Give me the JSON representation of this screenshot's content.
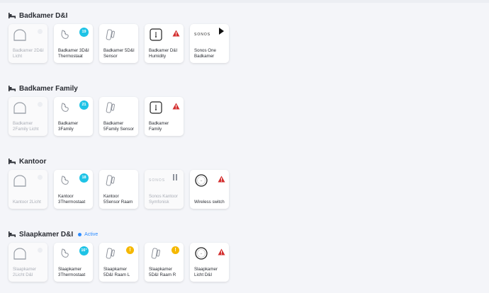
{
  "sections": [
    {
      "title": "Badkamer D&I",
      "tiles": [
        {
          "label": "Badkamer 2D&I Licht",
          "icon": "light-icon",
          "badge": "dot",
          "off": true
        },
        {
          "label": "Badkamer 3D&I Thermostaat",
          "icon": "thermostat-icon",
          "badge": "number",
          "badge_value": "19"
        },
        {
          "label": "Badkamer 5D&I Sensor",
          "icon": "door-sensor-icon",
          "badge": "none"
        },
        {
          "label": "Badkamer D&I Humidity",
          "icon": "humidity-icon",
          "badge": "alert"
        },
        {
          "label": "Sonos One Badkamer",
          "icon": "sonos-icon",
          "brand": "SONOS",
          "badge": "play"
        }
      ]
    },
    {
      "title": "Badkamer Family",
      "tiles": [
        {
          "label": "Badkamer 2Family Licht",
          "icon": "light-icon",
          "badge": "dot",
          "off": true
        },
        {
          "label": "Badkamer 3Family",
          "icon": "thermostat-icon",
          "badge": "number",
          "badge_value": "21"
        },
        {
          "label": "Badkamer 5Family Sensor",
          "icon": "door-sensor-icon",
          "badge": "none"
        },
        {
          "label": "Badkamer Family",
          "icon": "humidity-icon",
          "badge": "alert"
        }
      ]
    },
    {
      "title": "Kantoor",
      "tiles": [
        {
          "label": "Kantoor 2Licht",
          "icon": "light-icon",
          "badge": "dot",
          "off": true
        },
        {
          "label": "Kantoor 3Thermostaat",
          "icon": "thermostat-icon",
          "badge": "number",
          "badge_value": "18"
        },
        {
          "label": "Kantoor 5Sensor Raam",
          "icon": "door-sensor-icon",
          "badge": "none"
        },
        {
          "label": "Sonos Kantoor Symfonisk",
          "icon": "sonos-icon",
          "brand": "SONOS",
          "badge": "pause",
          "off": true
        },
        {
          "label": "Wireless switch",
          "icon": "switch-icon",
          "badge": "alert"
        }
      ]
    },
    {
      "title": "Slaapkamer D&I",
      "status": "Active",
      "tiles": [
        {
          "label": "Slaapkamer 2Licht D&I",
          "icon": "light-icon",
          "badge": "dot",
          "off": true
        },
        {
          "label": "Slaapkamer 3Thermostaat",
          "icon": "thermostat-icon",
          "badge": "number",
          "badge_value": "16°"
        },
        {
          "label": "Slaapkamer 5D&I Raam L",
          "icon": "door-sensor-icon",
          "badge": "warning",
          "badge_value": "!"
        },
        {
          "label": "Slaapkamer 5D&I Raam R",
          "icon": "door-sensor-icon",
          "badge": "warning",
          "badge_value": "!"
        },
        {
          "label": "Slaapkamer Licht D&I",
          "icon": "switch-icon",
          "badge": "alert"
        }
      ]
    }
  ],
  "colors": {
    "accent": "#2d8cff",
    "badge_cyan": "#1ec3e6",
    "warning": "#f5b800",
    "alert": "#d32f2f"
  }
}
